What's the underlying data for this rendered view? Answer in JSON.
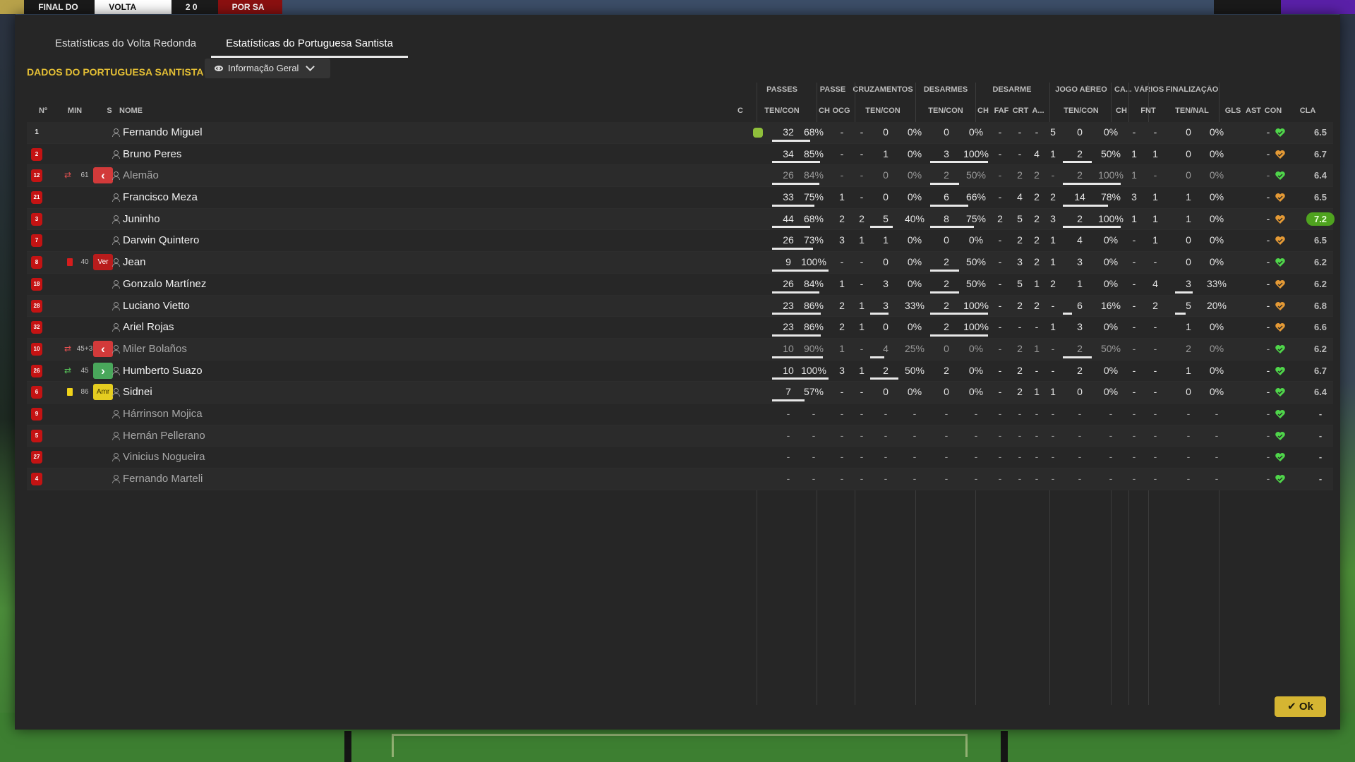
{
  "scorebar": {
    "stage": "FINAL DO",
    "home": "VOLTA",
    "score": "2 0",
    "away": "POR SA"
  },
  "tabs": [
    {
      "label": "Estatísticas do Volta Redonda",
      "active": false
    },
    {
      "label": "Estatísticas do Portuguesa Santista",
      "active": true
    }
  ],
  "section_title": "DADOS DO PORTUGUESA SANTISTA",
  "view_dropdown": {
    "selected": "Informação Geral"
  },
  "group_headers": [
    "PASSES",
    "PASSE",
    "CRUZAMENTOS",
    "DESARMES",
    "DESARME",
    "JOGO AÉREO",
    "CA...",
    "VÁRIOS",
    "FINALIZAÇÃO"
  ],
  "columns": {
    "num": "Nº",
    "min": "MIN",
    "s": "S",
    "name": "NOME",
    "c": "C",
    "passes": "TEN/CON",
    "pch": "CH",
    "pocg": "OCG",
    "cruz": "TEN/CON",
    "des": "TEN/CON",
    "dch": "CH",
    "dfaf": "FAF",
    "dcrt": "CRT",
    "da": "A...",
    "aer": "TEN/CON",
    "cach": "CH",
    "fnt": "FNT",
    "fin": "TEN/NAL",
    "gls": "GLS",
    "ast": "AST",
    "con": "CON",
    "cla": "CLA"
  },
  "players": [
    {
      "num": "1",
      "gk": true,
      "name": "Fernando Miguel",
      "dim": false,
      "min": "",
      "s": "",
      "evt": "",
      "trophy": true,
      "pt": "32",
      "pp": "68%",
      "pbar": 0.68,
      "pch": "-",
      "pocg": "-",
      "ct": "0",
      "cp": "0%",
      "cbar": 0,
      "dt": "0",
      "dp": "0%",
      "dbar": 0,
      "dch": "-",
      "faf": "-",
      "crt": "-",
      "da": "5",
      "at": "0",
      "ap": "0%",
      "abar": 0,
      "cach": "-",
      "fnt": "-",
      "ft": "0",
      "fp": "0%",
      "fbar": 0,
      "gls": "-",
      "heart": "green",
      "rating": "6.5",
      "best": false
    },
    {
      "num": "2",
      "name": "Bruno Peres",
      "dim": false,
      "min": "",
      "s": "",
      "evt": "",
      "pt": "34",
      "pp": "85%",
      "pbar": 0.85,
      "pch": "-",
      "pocg": "-",
      "ct": "1",
      "cp": "0%",
      "cbar": 0,
      "dt": "3",
      "dp": "100%",
      "dbar": 1,
      "dch": "-",
      "faf": "-",
      "crt": "4",
      "da": "1",
      "at": "2",
      "ap": "50%",
      "abar": 0.5,
      "cach": "1",
      "fnt": "1",
      "ft": "0",
      "fp": "0%",
      "fbar": 0,
      "gls": "-",
      "heart": "orange",
      "rating": "6.7",
      "best": false
    },
    {
      "num": "12",
      "name": "Alemão",
      "dim": true,
      "min": "61",
      "s": "off",
      "evt": "out",
      "pt": "26",
      "pp": "84%",
      "pbar": 0.84,
      "pch": "-",
      "pocg": "-",
      "ct": "0",
      "cp": "0%",
      "cbar": 0,
      "dt": "2",
      "dp": "50%",
      "dbar": 0.5,
      "dch": "-",
      "faf": "2",
      "crt": "2",
      "da": "-",
      "at": "2",
      "ap": "100%",
      "abar": 1,
      "cach": "1",
      "fnt": "-",
      "ft": "0",
      "fp": "0%",
      "fbar": 0,
      "gls": "-",
      "heart": "green",
      "rating": "6.4",
      "best": false
    },
    {
      "num": "21",
      "name": "Francisco Meza",
      "dim": false,
      "min": "",
      "s": "",
      "evt": "",
      "pt": "33",
      "pp": "75%",
      "pbar": 0.75,
      "pch": "1",
      "pocg": "-",
      "ct": "0",
      "cp": "0%",
      "cbar": 0,
      "dt": "6",
      "dp": "66%",
      "dbar": 0.66,
      "dch": "-",
      "faf": "4",
      "crt": "2",
      "da": "2",
      "at": "14",
      "ap": "78%",
      "abar": 0.78,
      "cach": "3",
      "fnt": "1",
      "ft": "1",
      "fp": "0%",
      "fbar": 0,
      "gls": "-",
      "heart": "orange",
      "rating": "6.5",
      "best": false
    },
    {
      "num": "3",
      "name": "Juninho",
      "dim": false,
      "min": "",
      "s": "",
      "evt": "",
      "pt": "44",
      "pp": "68%",
      "pbar": 0.68,
      "pch": "2",
      "pocg": "2",
      "ct": "5",
      "cp": "40%",
      "cbar": 0.4,
      "dt": "8",
      "dp": "75%",
      "dbar": 0.75,
      "dch": "2",
      "faf": "5",
      "crt": "2",
      "da": "3",
      "at": "2",
      "ap": "100%",
      "abar": 1,
      "cach": "1",
      "fnt": "1",
      "ft": "1",
      "fp": "0%",
      "fbar": 0,
      "gls": "-",
      "heart": "orange",
      "rating": "7.2",
      "best": true
    },
    {
      "num": "7",
      "name": "Darwin Quintero",
      "dim": false,
      "min": "",
      "s": "",
      "evt": "",
      "pt": "26",
      "pp": "73%",
      "pbar": 0.73,
      "pch": "3",
      "pocg": "1",
      "ct": "1",
      "cp": "0%",
      "cbar": 0,
      "dt": "0",
      "dp": "0%",
      "dbar": 0,
      "dch": "-",
      "faf": "2",
      "crt": "2",
      "da": "1",
      "at": "4",
      "ap": "0%",
      "abar": 0,
      "cach": "-",
      "fnt": "1",
      "ft": "0",
      "fp": "0%",
      "fbar": 0,
      "gls": "-",
      "heart": "orange",
      "rating": "6.5",
      "best": false
    },
    {
      "num": "8",
      "name": "Jean",
      "dim": false,
      "min": "40",
      "s": "red",
      "s_label": "Ver",
      "evt": "redcard",
      "pt": "9",
      "pp": "100%",
      "pbar": 1,
      "pch": "-",
      "pocg": "-",
      "ct": "0",
      "cp": "0%",
      "cbar": 0,
      "dt": "2",
      "dp": "50%",
      "dbar": 0.5,
      "dch": "-",
      "faf": "3",
      "crt": "2",
      "da": "1",
      "at": "3",
      "ap": "0%",
      "abar": 0,
      "cach": "-",
      "fnt": "-",
      "ft": "0",
      "fp": "0%",
      "fbar": 0,
      "gls": "-",
      "heart": "green",
      "rating": "6.2",
      "best": false
    },
    {
      "num": "18",
      "name": "Gonzalo Martínez",
      "dim": false,
      "min": "",
      "s": "",
      "evt": "",
      "pt": "26",
      "pp": "84%",
      "pbar": 0.84,
      "pch": "1",
      "pocg": "-",
      "ct": "3",
      "cp": "0%",
      "cbar": 0,
      "dt": "2",
      "dp": "50%",
      "dbar": 0.5,
      "dch": "-",
      "faf": "5",
      "crt": "1",
      "da": "2",
      "at": "1",
      "ap": "0%",
      "abar": 0,
      "cach": "-",
      "fnt": "4",
      "ft": "3",
      "fp": "33%",
      "fbar": 0.33,
      "gls": "-",
      "heart": "orange",
      "rating": "6.2",
      "best": false
    },
    {
      "num": "28",
      "name": "Luciano Vietto",
      "dim": false,
      "min": "",
      "s": "",
      "evt": "",
      "pt": "23",
      "pp": "86%",
      "pbar": 0.86,
      "pch": "2",
      "pocg": "1",
      "ct": "3",
      "cp": "33%",
      "cbar": 0.33,
      "dt": "2",
      "dp": "100%",
      "dbar": 1,
      "dch": "-",
      "faf": "2",
      "crt": "2",
      "da": "-",
      "at": "6",
      "ap": "16%",
      "abar": 0.16,
      "cach": "-",
      "fnt": "2",
      "ft": "5",
      "fp": "20%",
      "fbar": 0.2,
      "gls": "-",
      "heart": "orange",
      "rating": "6.8",
      "best": false
    },
    {
      "num": "32",
      "name": "Ariel Rojas",
      "dim": false,
      "min": "",
      "s": "",
      "evt": "",
      "pt": "23",
      "pp": "86%",
      "pbar": 0.86,
      "pch": "2",
      "pocg": "1",
      "ct": "0",
      "cp": "0%",
      "cbar": 0,
      "dt": "2",
      "dp": "100%",
      "dbar": 1,
      "dch": "-",
      "faf": "-",
      "crt": "-",
      "da": "1",
      "at": "3",
      "ap": "0%",
      "abar": 0,
      "cach": "-",
      "fnt": "-",
      "ft": "1",
      "fp": "0%",
      "fbar": 0,
      "gls": "-",
      "heart": "orange",
      "rating": "6.6",
      "best": false
    },
    {
      "num": "10",
      "name": "Miler Bolaños",
      "dim": true,
      "min": "45+3",
      "s": "off",
      "evt": "out",
      "pt": "10",
      "pp": "90%",
      "pbar": 0.9,
      "pch": "1",
      "pocg": "-",
      "ct": "4",
      "cp": "25%",
      "cbar": 0.25,
      "dt": "0",
      "dp": "0%",
      "dbar": 0,
      "dch": "-",
      "faf": "2",
      "crt": "1",
      "da": "-",
      "at": "2",
      "ap": "50%",
      "abar": 0.5,
      "cach": "-",
      "fnt": "-",
      "ft": "2",
      "fp": "0%",
      "fbar": 0,
      "gls": "-",
      "heart": "green",
      "rating": "6.2",
      "best": false
    },
    {
      "num": "26",
      "name": "Humberto Suazo",
      "dim": false,
      "min": "45",
      "s": "on",
      "evt": "in",
      "pt": "10",
      "pp": "100%",
      "pbar": 1,
      "pch": "3",
      "pocg": "1",
      "ct": "2",
      "cp": "50%",
      "cbar": 0.5,
      "dt": "2",
      "dp": "0%",
      "dbar": 0,
      "dch": "-",
      "faf": "2",
      "crt": "-",
      "da": "-",
      "at": "2",
      "ap": "0%",
      "abar": 0,
      "cach": "-",
      "fnt": "-",
      "ft": "1",
      "fp": "0%",
      "fbar": 0,
      "gls": "-",
      "heart": "green",
      "rating": "6.7",
      "best": false
    },
    {
      "num": "6",
      "name": "Sidnei",
      "dim": false,
      "min": "86",
      "s": "yel",
      "s_label": "Amr",
      "evt": "yelcard",
      "pt": "7",
      "pp": "57%",
      "pbar": 0.57,
      "pch": "-",
      "pocg": "-",
      "ct": "0",
      "cp": "0%",
      "cbar": 0,
      "dt": "0",
      "dp": "0%",
      "dbar": 0,
      "dch": "-",
      "faf": "2",
      "crt": "1",
      "da": "1",
      "at": "0",
      "ap": "0%",
      "abar": 0,
      "cach": "-",
      "fnt": "-",
      "ft": "0",
      "fp": "0%",
      "fbar": 0,
      "gls": "-",
      "heart": "green",
      "rating": "6.4",
      "best": false
    },
    {
      "num": "9",
      "name": "Hárrinson Mojica",
      "dim": true,
      "min": "",
      "s": "",
      "evt": "",
      "pt": "-",
      "pp": "-",
      "pbar": 0,
      "pch": "-",
      "pocg": "-",
      "ct": "-",
      "cp": "-",
      "cbar": 0,
      "dt": "-",
      "dp": "-",
      "dbar": 0,
      "dch": "-",
      "faf": "-",
      "crt": "-",
      "da": "-",
      "at": "-",
      "ap": "-",
      "abar": 0,
      "cach": "-",
      "fnt": "-",
      "ft": "-",
      "fp": "-",
      "fbar": 0,
      "gls": "-",
      "heart": "green",
      "rating": "-",
      "best": false
    },
    {
      "num": "5",
      "name": "Hernán Pellerano",
      "dim": true,
      "min": "",
      "s": "",
      "evt": "",
      "pt": "-",
      "pp": "-",
      "pbar": 0,
      "pch": "-",
      "pocg": "-",
      "ct": "-",
      "cp": "-",
      "cbar": 0,
      "dt": "-",
      "dp": "-",
      "dbar": 0,
      "dch": "-",
      "faf": "-",
      "crt": "-",
      "da": "-",
      "at": "-",
      "ap": "-",
      "abar": 0,
      "cach": "-",
      "fnt": "-",
      "ft": "-",
      "fp": "-",
      "fbar": 0,
      "gls": "-",
      "heart": "green",
      "rating": "-",
      "best": false
    },
    {
      "num": "27",
      "name": "Vinicius Nogueira",
      "dim": true,
      "min": "",
      "s": "",
      "evt": "",
      "pt": "-",
      "pp": "-",
      "pbar": 0,
      "pch": "-",
      "pocg": "-",
      "ct": "-",
      "cp": "-",
      "cbar": 0,
      "dt": "-",
      "dp": "-",
      "dbar": 0,
      "dch": "-",
      "faf": "-",
      "crt": "-",
      "da": "-",
      "at": "-",
      "ap": "-",
      "abar": 0,
      "cach": "-",
      "fnt": "-",
      "ft": "-",
      "fp": "-",
      "fbar": 0,
      "gls": "-",
      "heart": "green",
      "rating": "-",
      "best": false
    },
    {
      "num": "4",
      "name": "Fernando Marteli",
      "dim": true,
      "min": "",
      "s": "",
      "evt": "",
      "pt": "-",
      "pp": "-",
      "pbar": 0,
      "pch": "-",
      "pocg": "-",
      "ct": "-",
      "cp": "-",
      "cbar": 0,
      "dt": "-",
      "dp": "-",
      "dbar": 0,
      "dch": "-",
      "faf": "-",
      "crt": "-",
      "da": "-",
      "at": "-",
      "ap": "-",
      "abar": 0,
      "cach": "-",
      "fnt": "-",
      "ft": "-",
      "fp": "-",
      "fbar": 0,
      "gls": "-",
      "heart": "green",
      "rating": "-",
      "best": false
    }
  ],
  "colors": {
    "accent": "#e4bf35",
    "heart_green": "#4fd64a",
    "heart_orange": "#e59a35",
    "best_rating": "#4fa31f"
  },
  "icons": {
    "view": "eye-icon",
    "dropdown": "chevron-down-icon",
    "player": "person-icon",
    "ok": "check-icon",
    "morale": "heart-icon"
  },
  "ok_button": {
    "label": "Ok"
  }
}
